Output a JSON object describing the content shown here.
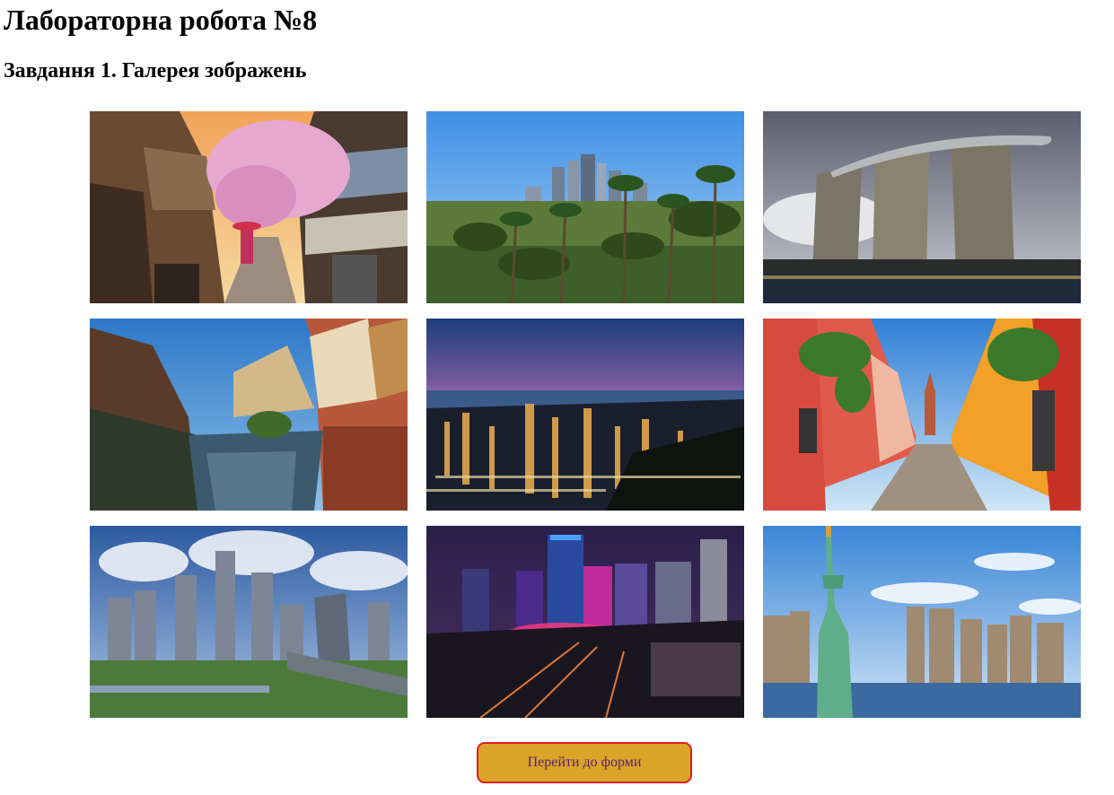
{
  "header": {
    "title": "Лабораторна робота №8"
  },
  "task": {
    "title": "Завдання 1. Галерея зображень"
  },
  "gallery": {
    "images": [
      {
        "subject": "kyoto-street-cherry-blossom"
      },
      {
        "subject": "los-angeles-palms-skyline"
      },
      {
        "subject": "singapore-marina-bay-sands"
      },
      {
        "subject": "colmar-half-timbered-canal"
      },
      {
        "subject": "hong-kong-night-skyline"
      },
      {
        "subject": "san-miguel-colorful-street"
      },
      {
        "subject": "beijing-cbd-skyline"
      },
      {
        "subject": "neon-city-night-traffic"
      },
      {
        "subject": "new-york-statue-of-liberty"
      }
    ]
  },
  "actions": {
    "form_button_label": "Перейти до форми"
  },
  "colors": {
    "button_background": "#d9a428",
    "button_border": "#e01e1e",
    "button_text": "#5a1f6e"
  }
}
